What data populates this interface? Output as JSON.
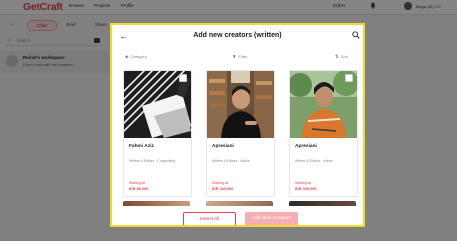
{
  "app": {
    "logo": "GetCraft",
    "nav": [
      "Browse",
      "Projects",
      "Profile"
    ],
    "language": "ID|EN",
    "user": "Mega (ID) 1.0",
    "tabs": [
      "Chat",
      "Brief",
      "Share"
    ],
    "search_placeholder": "Search",
    "workspace_title": "Reinel's workspace",
    "workspace_subtitle": "Direct chat with the creators..."
  },
  "modal": {
    "title": "Add new creators (written)",
    "filters": {
      "category": "Category",
      "filter": "Filter",
      "sort": "Sort"
    },
    "cards": [
      {
        "name": "Fahmi Aziz",
        "category": "Writers & Editors · Copywriting",
        "starting_at": "Starting at",
        "price": "IDR 80,000"
      },
      {
        "name": "Apresiani",
        "category": "Writers & Editors · Article",
        "starting_at": "Starting at",
        "price": "IDR 300,000"
      },
      {
        "name": "Apresiani",
        "category": "Writers & Editors · Article",
        "starting_at": "Starting at",
        "price": "IDR 300,000"
      }
    ],
    "select_all": "Select All",
    "add_button": "Add New Creators"
  },
  "colors": {
    "brand": "#e8414e",
    "highlight_border": "#f2d928",
    "disabled_button": "#f5aeb4"
  }
}
